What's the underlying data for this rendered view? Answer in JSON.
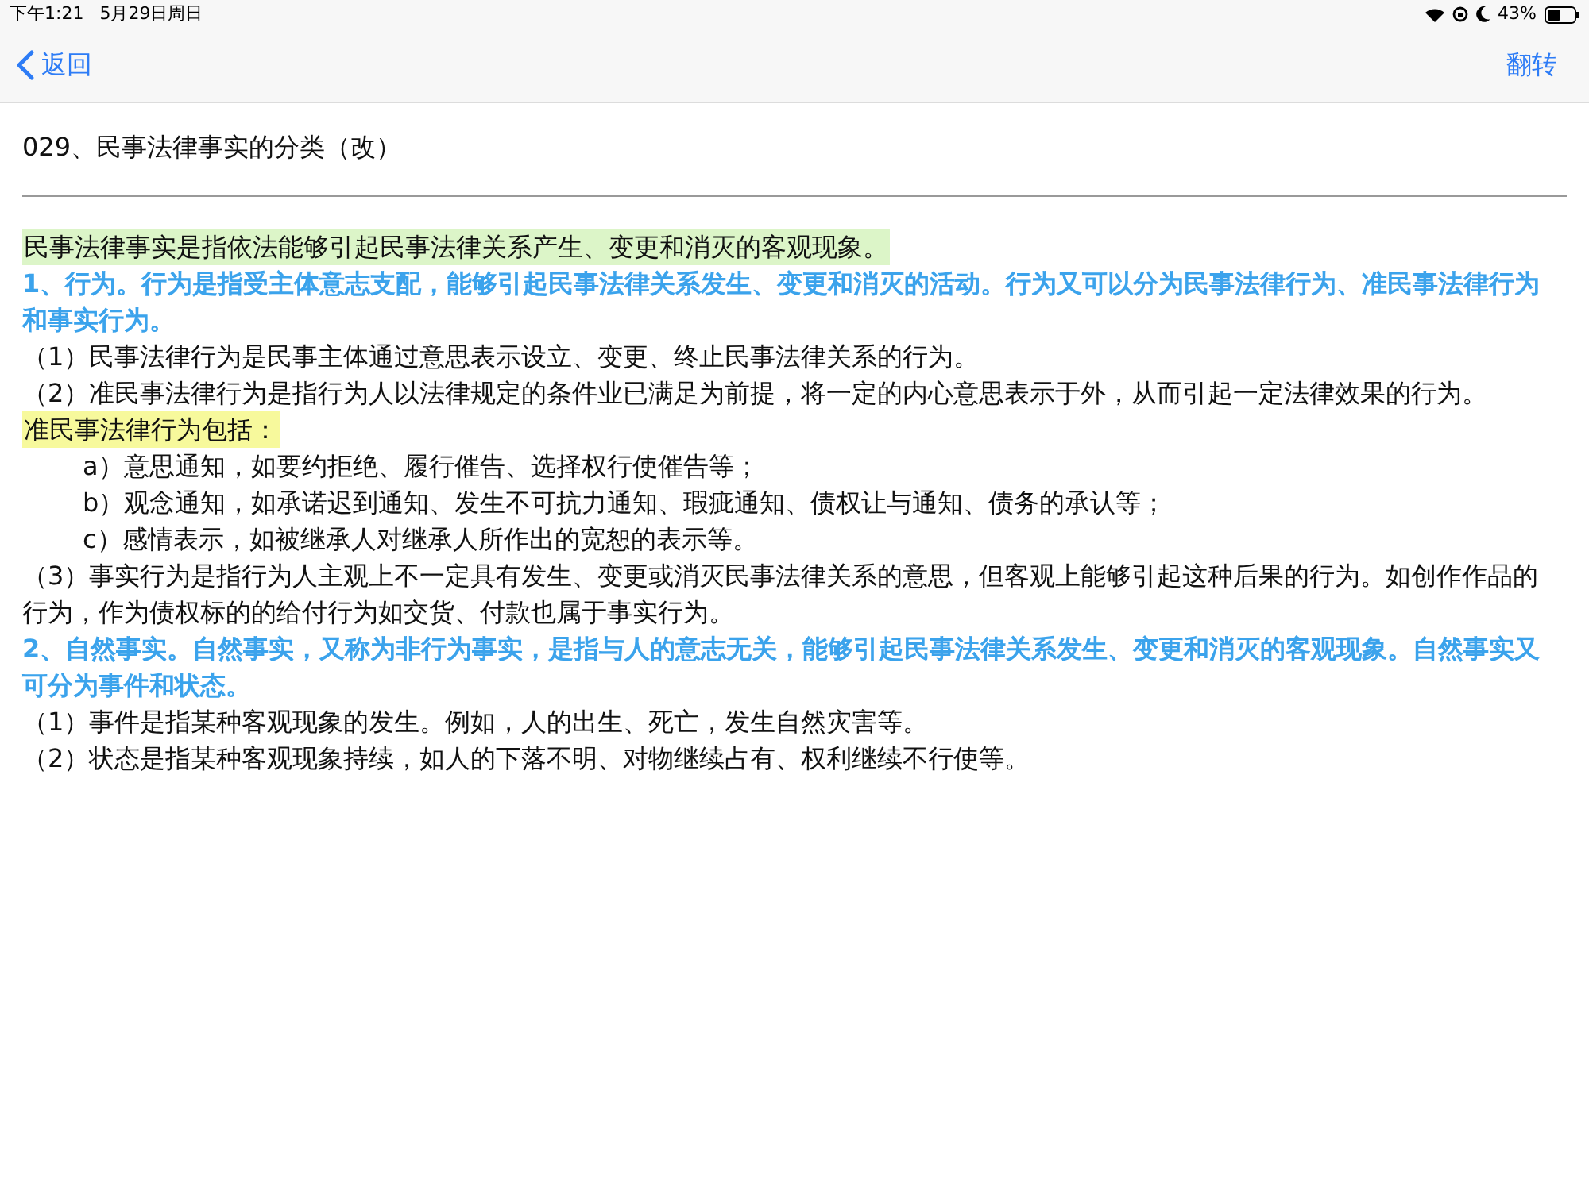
{
  "status_bar": {
    "time": "下午1:21",
    "date": "5月29日周日",
    "battery": "43%"
  },
  "nav": {
    "back": "返回",
    "action": "翻转"
  },
  "title": "029、民事法律事实的分类（改）",
  "paragraphs": [
    {
      "kind": "highlight",
      "color": "#dcf5c8",
      "text": "民事法律事实是指依法能够引起民事法律关系产生、变更和消灭的客观现象。"
    },
    {
      "kind": "heading",
      "text": "1、行为。行为是指受主体意志支配，能够引起民事法律关系发生、变更和消灭的活动。行为又可以分为民事法律行为、准民事法律行为和事实行为。"
    },
    {
      "kind": "body",
      "text": "（1）民事法律行为是民事主体通过意思表示设立、变更、终止民事法律关系的行为。"
    },
    {
      "kind": "body",
      "text": "（2）准民事法律行为是指行为人以法律规定的条件业已满足为前提，将一定的内心意思表示于外，从而引起一定法律效果的行为。"
    },
    {
      "kind": "highlight",
      "color": "#f7f99c",
      "text": "准民事法律行为包括："
    },
    {
      "kind": "item",
      "text": "a）意思通知，如要约拒绝、履行催告、选择权行使催告等；"
    },
    {
      "kind": "item",
      "text": "b）观念通知，如承诺迟到通知、发生不可抗力通知、瑕疵通知、债权让与通知、债务的承认等；"
    },
    {
      "kind": "item",
      "text": "c）感情表示，如被继承人对继承人所作出的宽恕的表示等。"
    },
    {
      "kind": "body",
      "text": "（3）事实行为是指行为人主观上不一定具有发生、变更或消灭民事法律关系的意思，但客观上能够引起这种后果的行为。如创作作品的行为，作为债权标的的给付行为如交货、付款也属于事实行为。"
    },
    {
      "kind": "heading",
      "text": "2、自然事实。自然事实，又称为非行为事实，是指与人的意志无关，能够引起民事法律关系发生、变更和消灭的客观现象。自然事实又可分为事件和状态。"
    },
    {
      "kind": "body",
      "text": "（1）事件是指某种客观现象的发生。例如，人的出生、死亡，发生自然灾害等。"
    },
    {
      "kind": "body",
      "text": "（2）状态是指某种客观现象持续，如人的下落不明、对物继续占有、权利继续不行使等。"
    }
  ]
}
